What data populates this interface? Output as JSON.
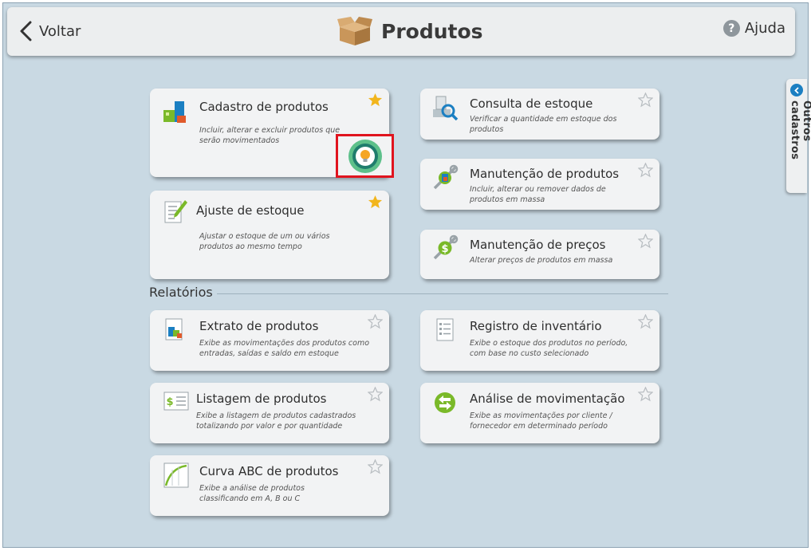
{
  "header": {
    "back_label": "Voltar",
    "title": "Produtos",
    "help_label": "Ajuda",
    "help_symbol": "?"
  },
  "side_tab": {
    "label": "Outros cadastros"
  },
  "section": {
    "reports_title": "Relatórios"
  },
  "cards": {
    "cadastro": {
      "title": "Cadastro de produtos",
      "desc": "Incluir, alterar e excluir produtos que serão movimentados",
      "favorite": true
    },
    "ajuste": {
      "title": "Ajuste de estoque",
      "desc": "Ajustar o estoque de um ou vários produtos ao mesmo tempo",
      "favorite": true
    },
    "consulta": {
      "title": "Consulta de estoque",
      "desc": "Verificar a quantidade em estoque dos produtos",
      "favorite": false
    },
    "manutencao_produtos": {
      "title": "Manutenção de produtos",
      "desc": "Incluir, alterar ou remover dados de produtos em massa",
      "favorite": false
    },
    "manutencao_precos": {
      "title": "Manutenção de preços",
      "desc": "Alterar preços de produtos em massa",
      "favorite": false
    },
    "extrato": {
      "title": "Extrato de produtos",
      "desc": "Exibe as movimentações dos produtos como entradas, saídas e saldo em estoque",
      "favorite": false
    },
    "registro": {
      "title": "Registro de inventário",
      "desc": "Exibe o estoque dos produtos no período, com base no custo selecionado",
      "favorite": false
    },
    "listagem": {
      "title": "Listagem de produtos",
      "desc": "Exibe a listagem de produtos cadastrados totalizando por valor e por quantidade",
      "favorite": false
    },
    "analise": {
      "title": "Análise de movimentação",
      "desc": "Exibe as movimentações por cliente / fornecedor em determinado período",
      "favorite": false
    },
    "curva": {
      "title": "Curva ABC de produtos",
      "desc": "Exibe a análise de produtos classificando em A, B ou C",
      "favorite": false
    }
  },
  "colors": {
    "star_active": "#f2b51c",
    "star_inactive": "#b8bdc1",
    "highlight_border": "#e0141e",
    "accent_blue": "#1b7fc2",
    "accent_green": "#7ab929"
  }
}
